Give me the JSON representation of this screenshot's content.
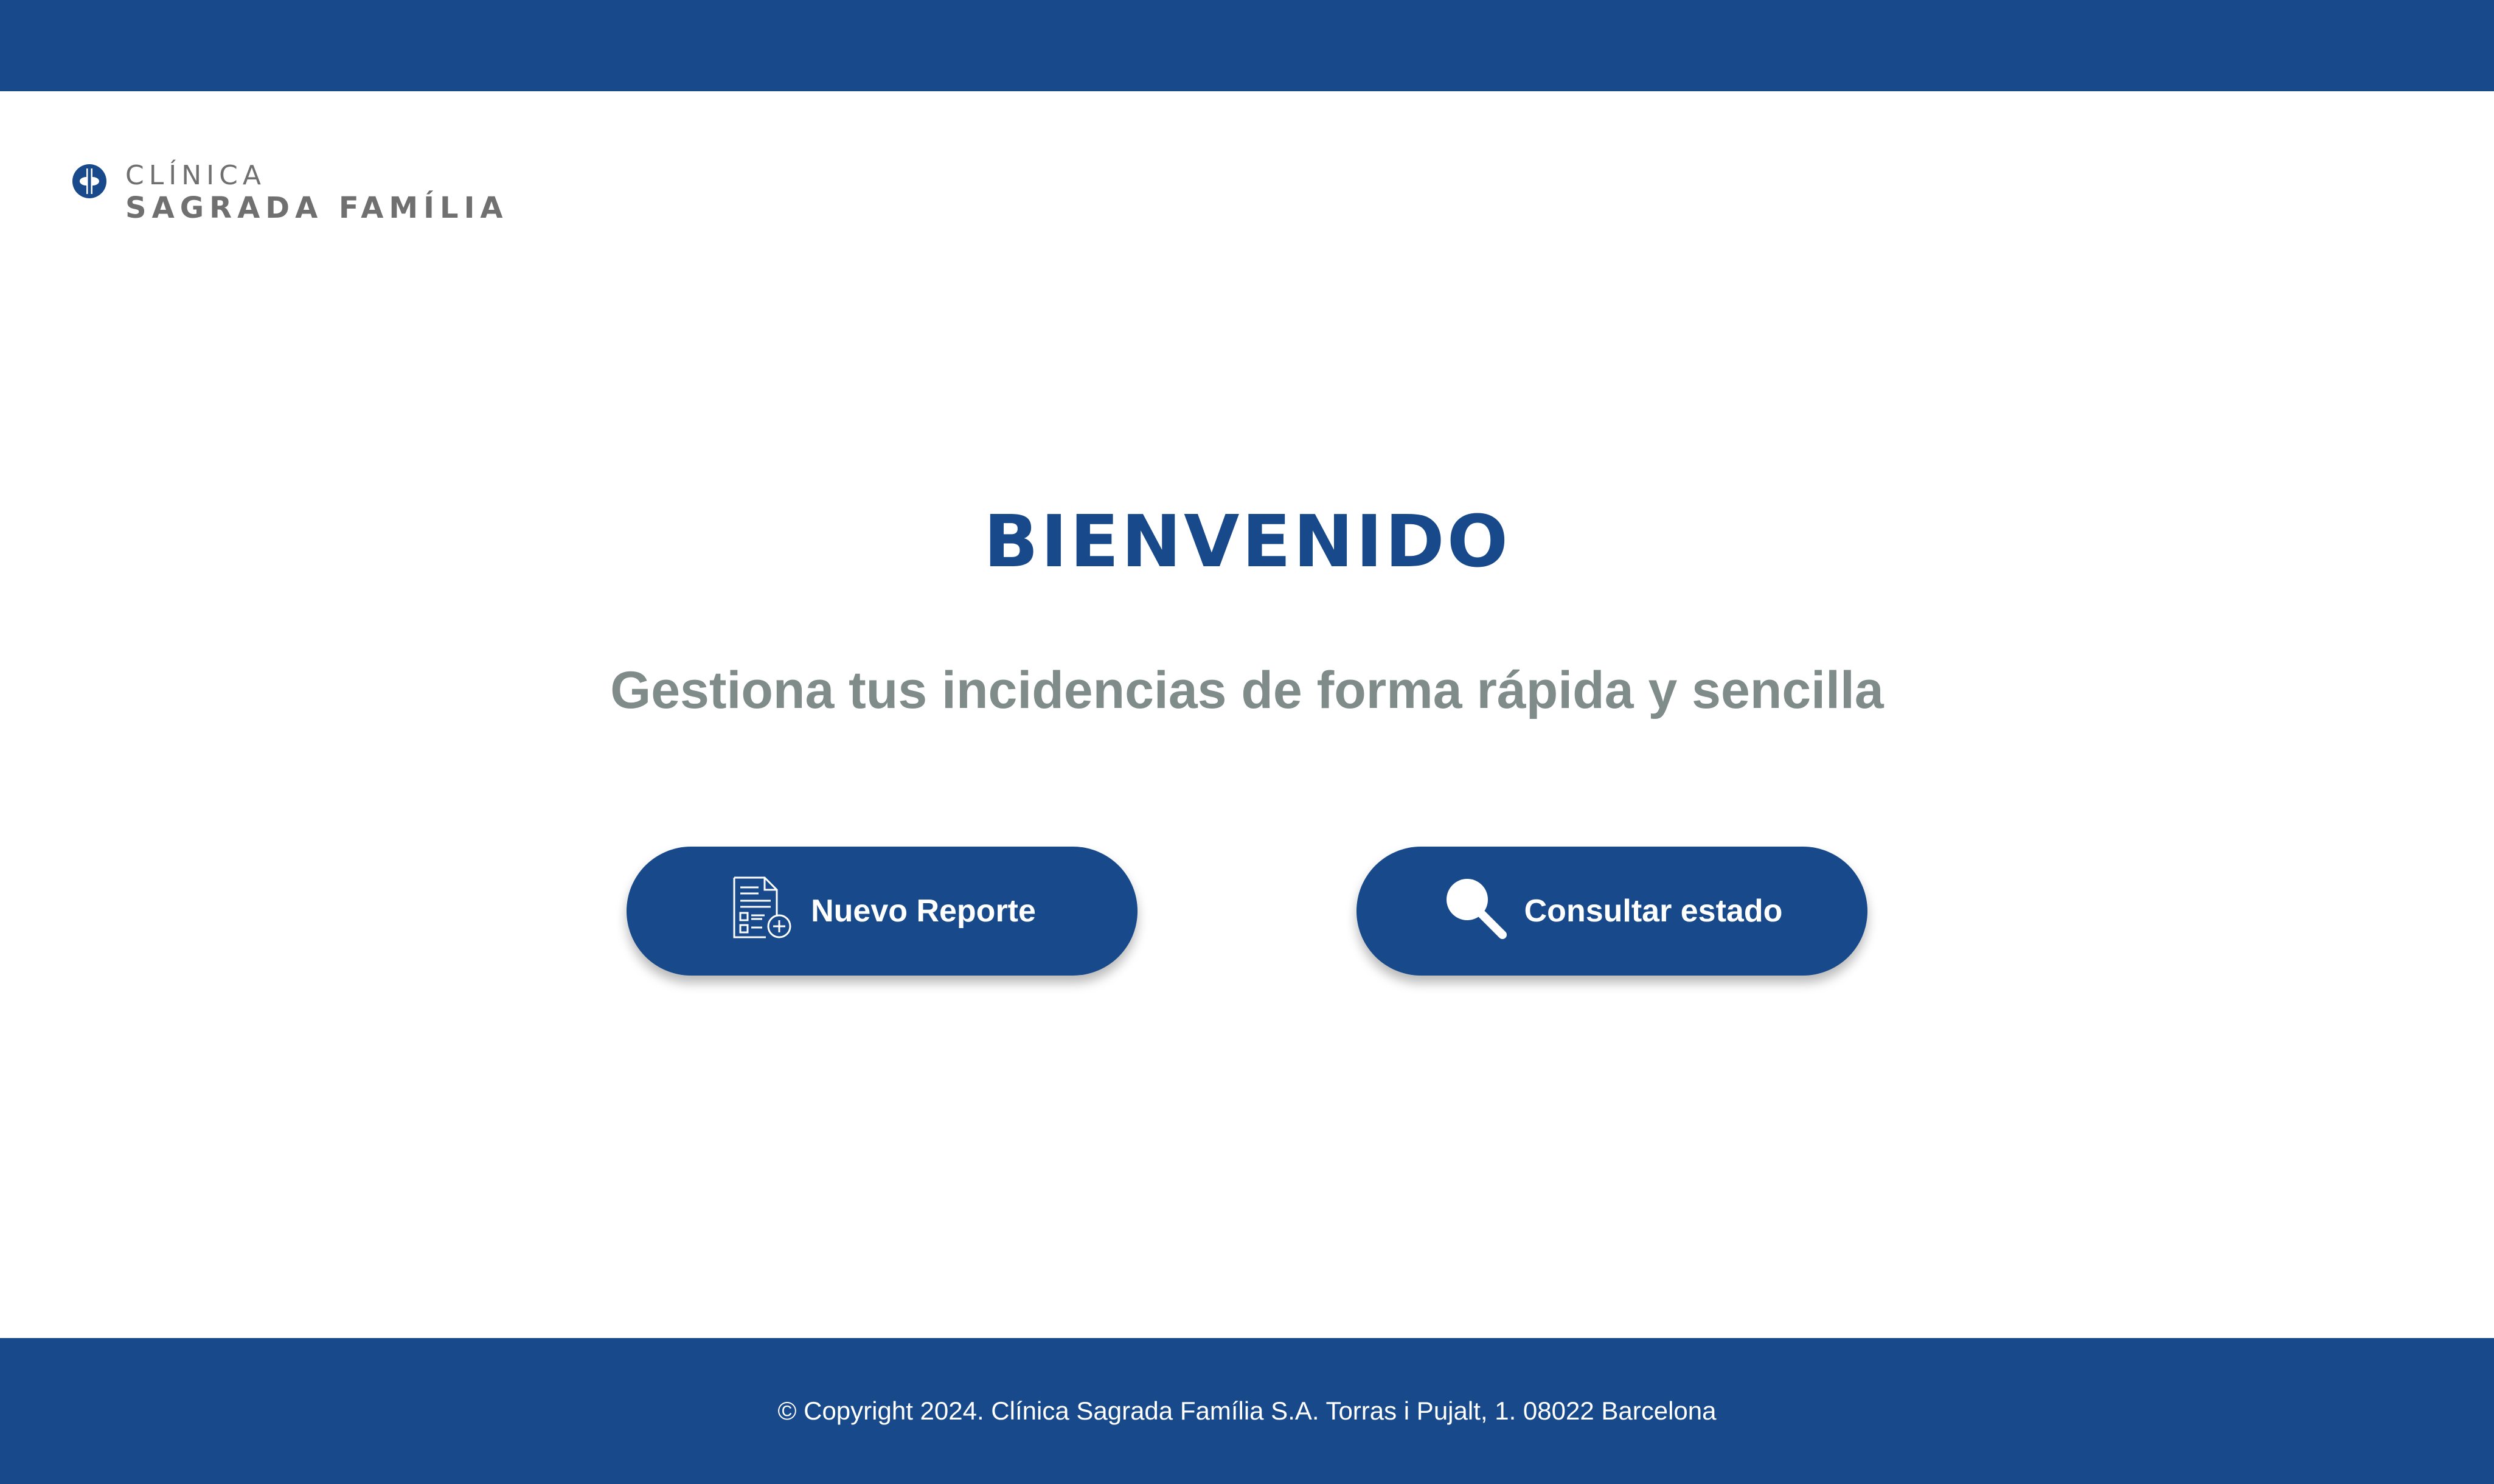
{
  "header": {
    "bar_color": "#17498b"
  },
  "logo": {
    "icon": "cross-circle-icon",
    "line1": "CLÍNICA",
    "line2": "SAGRADA FAMÍLIA"
  },
  "main": {
    "title": "BIENVENIDO",
    "subtitle": "Gestiona tus incidencias de forma rápida y sencilla",
    "buttons": [
      {
        "label": "Nuevo Reporte",
        "icon": "new-report-icon"
      },
      {
        "label": "Consultar estado",
        "icon": "search-icon"
      }
    ]
  },
  "footer": {
    "text": "© Copyright 2024. Clínica Sagrada Família S.A. Torras i Pujalt, 1. 08022 Barcelona"
  },
  "colors": {
    "brand": "#17498b",
    "subtitle": "#7f8c8a",
    "logo_text": "#707070"
  }
}
